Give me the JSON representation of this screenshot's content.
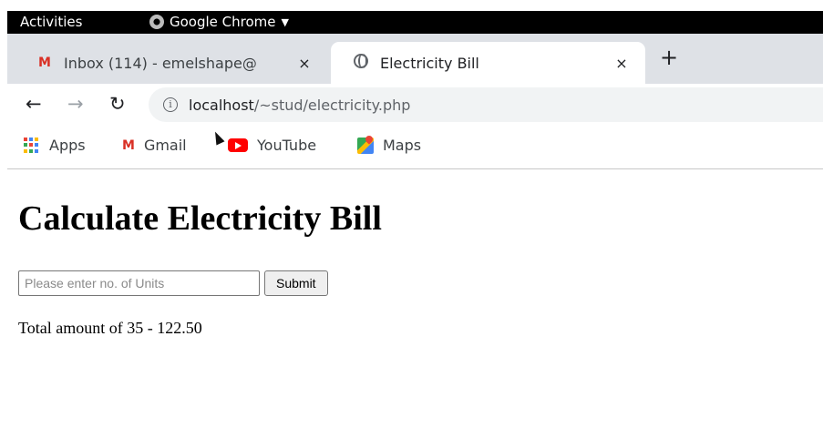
{
  "os_topbar": {
    "activities_label": "Activities",
    "app_label": "Google Chrome"
  },
  "browser": {
    "tabs": [
      {
        "title": "Inbox (114) - emelshape@",
        "icon": "gmail-icon",
        "active": false
      },
      {
        "title": "Electricity Bill",
        "icon": "globe-icon",
        "active": true
      }
    ],
    "close_glyph": "×",
    "new_tab_glyph": "+",
    "address_bar": {
      "host": "localhost",
      "path": "/~stud/electricity.php"
    },
    "bookmarks": [
      {
        "label": "Apps",
        "icon": "apps-grid-icon"
      },
      {
        "label": "Gmail",
        "icon": "gmail-icon"
      },
      {
        "label": "YouTube",
        "icon": "youtube-icon"
      },
      {
        "label": "Maps",
        "icon": "maps-icon"
      }
    ]
  },
  "page": {
    "heading": "Calculate Electricity Bill",
    "units_input": {
      "value": "",
      "placeholder": "Please enter no. of Units"
    },
    "submit_label": "Submit",
    "result_text": "Total amount of 35 - 122.50"
  },
  "colors": {
    "tabstrip_bg": "#dee1e6",
    "gmail_red": "#d93025",
    "youtube_red": "#ff0000"
  }
}
